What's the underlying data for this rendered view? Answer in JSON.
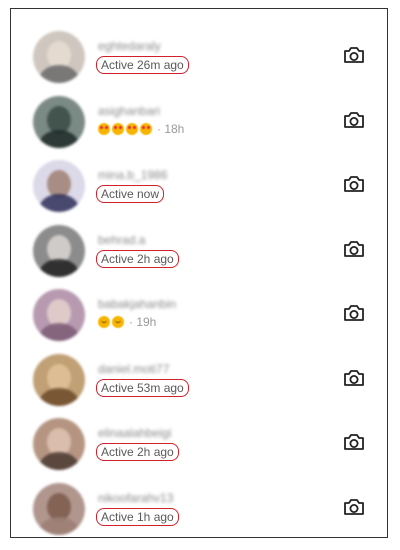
{
  "contacts": [
    {
      "username": "eghtedaraly",
      "status": "Active 26m ago",
      "boxed": true,
      "emoji": [],
      "time": "",
      "colors": {
        "bg": "#cfc7bf",
        "face": "#e8ddd2",
        "body": "#6a6a6a"
      }
    },
    {
      "username": "asighanbari",
      "status": "",
      "boxed": false,
      "emoji": [
        "heart-eyes-emoji",
        "heart-eyes-emoji",
        "heart-eyes-emoji",
        "heart-eyes-emoji"
      ],
      "time": "· 18h",
      "colors": {
        "bg": "#7c8a85",
        "face": "#3a4a45",
        "body": "#1f2a28"
      }
    },
    {
      "username": "mina.b_1986",
      "status": "Active now",
      "boxed": true,
      "emoji": [],
      "time": "",
      "colors": {
        "bg": "#dcd9e8",
        "face": "#9f7f72",
        "body": "#2f2f5a"
      }
    },
    {
      "username": "behrad.a",
      "status": "Active 2h ago",
      "boxed": true,
      "emoji": [],
      "time": "",
      "colors": {
        "bg": "#8c8c8c",
        "face": "#dad6d3",
        "body": "#202020"
      }
    },
    {
      "username": "babakjahanbin",
      "status": "",
      "boxed": false,
      "emoji": [
        "wink-emoji",
        "wink-emoji"
      ],
      "time": "· 19h",
      "colors": {
        "bg": "#b79ab0",
        "face": "#e6d2cf",
        "body": "#7d5a76"
      }
    },
    {
      "username": "daniel.moti77",
      "status": "Active 53m ago",
      "boxed": true,
      "emoji": [],
      "time": "",
      "colors": {
        "bg": "#c0a074",
        "face": "#e2c39a",
        "body": "#6c4a2a"
      }
    },
    {
      "username": "elinaalahbeigi",
      "status": "Active 2h ago",
      "boxed": true,
      "emoji": [],
      "time": "",
      "colors": {
        "bg": "#b59582",
        "face": "#e0c4b4",
        "body": "#4a3a33"
      }
    },
    {
      "username": "nikoofarahv13",
      "status": "Active 1h ago",
      "boxed": true,
      "emoji": [],
      "time": "",
      "colors": {
        "bg": "#b0968d",
        "face": "#7c5a4a",
        "body": "#9c7e74"
      }
    }
  ],
  "icons": {
    "camera": "camera-icon"
  },
  "colors": {
    "highlight": "#d2202a"
  }
}
